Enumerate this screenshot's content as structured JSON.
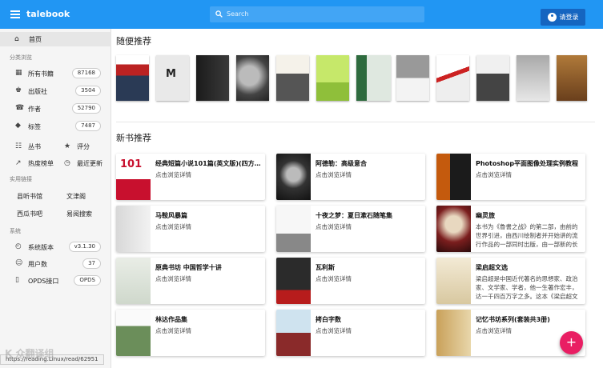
{
  "app": {
    "title": "talebook"
  },
  "search": {
    "placeholder": "Search"
  },
  "login": {
    "label": "请登录"
  },
  "sidebar": {
    "home": "首页",
    "section_browse": "分类浏览",
    "browse": [
      {
        "label": "所有书籍",
        "count": "87168",
        "icon": "grid-icon"
      },
      {
        "label": "出版社",
        "count": "3504",
        "icon": "publisher-icon"
      },
      {
        "label": "作者",
        "count": "52790",
        "icon": "author-icon"
      },
      {
        "label": "标签",
        "count": "7487",
        "icon": "tag-icon"
      }
    ],
    "congshu": "丛书",
    "pingfen": "评分",
    "rebang": "热度榜单",
    "zuijin": "最近更新",
    "section_tools": "实用链接",
    "links": [
      "县听书馆",
      "文津阁",
      "西瓜书吧",
      "易阅搜索"
    ],
    "section_system": "系统",
    "system": [
      {
        "label": "系统版本",
        "value": "v3.1.30",
        "icon": "history-icon"
      },
      {
        "label": "用户数",
        "value": "37",
        "icon": "users-icon"
      },
      {
        "label": "OPDS接口",
        "value": "OPDS",
        "icon": "phone-icon"
      }
    ]
  },
  "main": {
    "random_title": "随便推荐",
    "new_title": "新书推荐",
    "cards": [
      {
        "title": "经典短篇小说101篇(英文版)(四方...",
        "desc": "点击浏览详情"
      },
      {
        "title": "阿德勒：高级意合",
        "desc": "点击浏览详情"
      },
      {
        "title": "Photoshop平面图像处理实例教程",
        "desc": "点击浏览详情"
      },
      {
        "title": "马鞍风暴篇",
        "desc": "点击浏览详情"
      },
      {
        "title": "十夜之梦：夏日漱石随笔集",
        "desc": "点击浏览详情"
      },
      {
        "title": "幽灵旅",
        "desc": "本书为《魯書之战》的第二部，由前的世界引进，由西川绘制者并开始讲的流行作品的一部同时出版，由一部新的长篇幻想作品《老人路》之后"
      },
      {
        "title": "原典书坊 中国哲学十讲",
        "desc": "点击浏览详情"
      },
      {
        "title": "瓦利斯",
        "desc": "点击浏览详情"
      },
      {
        "title": "梁启超文选",
        "desc": "梁启超是中国近代著名的思想家、政治家、文学家、学者，他一生著作宏丰，达一千四百万字之多。这本《梁启超文选》..."
      },
      {
        "title": "林达作品集",
        "desc": "点击浏览详情"
      },
      {
        "title": "拷白字数",
        "desc": "点击浏览详情"
      },
      {
        "title": "记忆书坊系列(套装共3册)",
        "desc": "点击浏览详情"
      }
    ]
  },
  "status": {
    "url": "https://reading.Linux/read/62951"
  },
  "watermark": "K   众翻译组",
  "colors": {
    "primary": "#2196f3",
    "accent": "#e91e63",
    "login": "#1565c0"
  }
}
